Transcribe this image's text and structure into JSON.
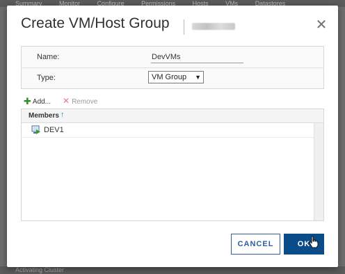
{
  "background": {
    "tabs": [
      "Summary",
      "Monitor",
      "Configure",
      "Permissions",
      "Hosts",
      "VMs",
      "Datastores"
    ],
    "footer_text": "Activating Cluster"
  },
  "dialog": {
    "title": "Create VM/Host Group",
    "close_icon": "close-icon",
    "form": {
      "name_label": "Name:",
      "name_value": "DevVMs",
      "type_label": "Type:",
      "type_value": "VM Group"
    },
    "toolbar": {
      "add_label": "Add...",
      "remove_label": "Remove"
    },
    "grid": {
      "column_header": "Members",
      "rows": [
        {
          "label": "DEV1",
          "icon": "vm-icon"
        }
      ]
    },
    "buttons": {
      "cancel": "CANCEL",
      "ok": "OK"
    },
    "colors": {
      "primary": "#0a4c89",
      "accent": "#2a7fbf",
      "add_green": "#2f8f2f",
      "remove_red": "#e27b7b"
    }
  }
}
